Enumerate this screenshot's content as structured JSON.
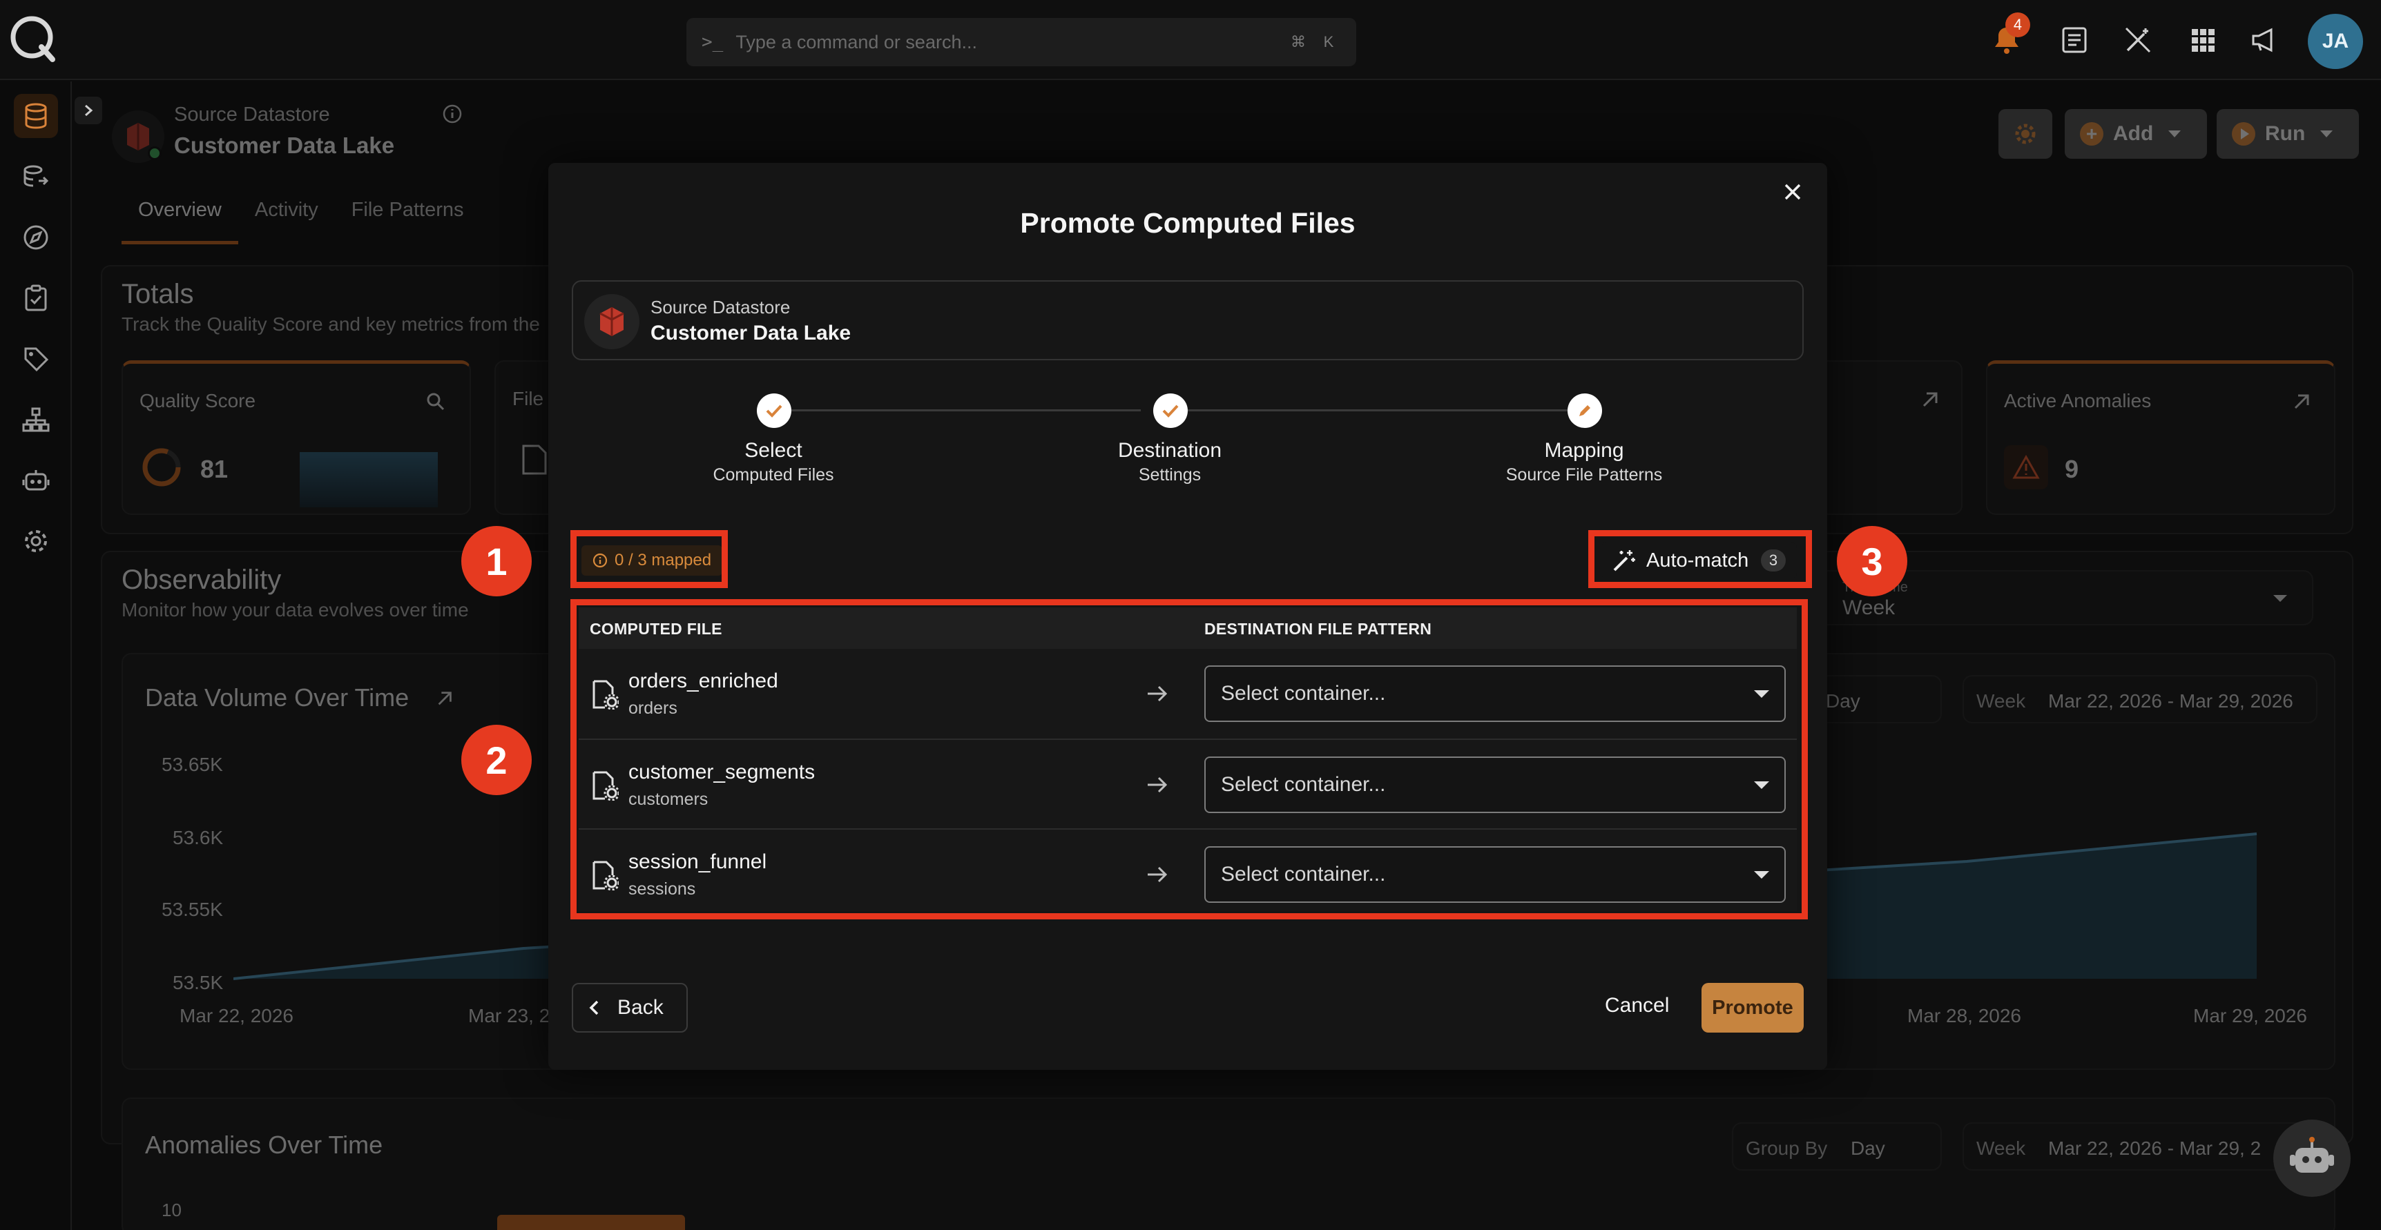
{
  "topbar": {
    "search_placeholder": "Type a command or search...",
    "shortcut_keys": [
      "⌘",
      "K"
    ],
    "notification_count": "4",
    "avatar_initials": "JA"
  },
  "datastore": {
    "label": "Source Datastore",
    "name": "Customer Data Lake"
  },
  "page_tabs": [
    "Overview",
    "Activity",
    "File Patterns"
  ],
  "header_buttons": {
    "add": "Add",
    "run": "Run"
  },
  "background": {
    "totals_title": "Totals",
    "totals_sub": "Track the Quality Score and key metrics from the",
    "quality_label": "Quality Score",
    "quality_value": "81",
    "file_label": "File I",
    "active_anomalies_label": "Active Anomalies",
    "active_anomalies_value": "9",
    "obs_title": "Observability",
    "obs_sub": "Monitor how your data evolves over time",
    "timeframe_label": "Timeframe",
    "timeframe_value": "Week",
    "volume_title": "Data Volume Over Time",
    "group_by_label": "Group By",
    "group_by_value": "Day",
    "range_label": "Week",
    "range_value": "Mar 22, 2026 - Mar 29, 2026",
    "y_ticks": [
      "53.65K",
      "53.6K",
      "53.55K",
      "53.5K"
    ],
    "x_ticks": [
      "Mar 22, 2026",
      "Mar 23, 2",
      "Mar 28, 2026",
      "Mar 29, 2026"
    ],
    "anomalies_title": "Anomalies Over Time",
    "anomalies_range_value": "Mar 22, 2026 - Mar 29, 2",
    "anomalies_y_tick": "10"
  },
  "modal": {
    "title": "Promote Computed Files",
    "source_label": "Source Datastore",
    "source_name": "Customer Data Lake",
    "steps": [
      {
        "title": "Select",
        "subtitle": "Computed Files",
        "state": "done"
      },
      {
        "title": "Destination",
        "subtitle": "Settings",
        "state": "done"
      },
      {
        "title": "Mapping",
        "subtitle": "Source File Patterns",
        "state": "current"
      }
    ],
    "mapped_status": "0 / 3 mapped",
    "auto_match_label": "Auto-match",
    "auto_match_count": "3",
    "columns": [
      "COMPUTED FILE",
      "DESTINATION FILE PATTERN"
    ],
    "rows": [
      {
        "file": "orders_enriched",
        "source": "orders",
        "select_placeholder": "Select container..."
      },
      {
        "file": "customer_segments",
        "source": "customers",
        "select_placeholder": "Select container..."
      },
      {
        "file": "session_funnel",
        "source": "sessions",
        "select_placeholder": "Select container..."
      }
    ],
    "back_label": "Back",
    "cancel_label": "Cancel",
    "promote_label": "Promote"
  },
  "annotations": [
    "1",
    "2",
    "3"
  ],
  "colors": {
    "accent": "#c6843f",
    "highlight": "#e8361e",
    "brand_orange": "#c8651d"
  }
}
